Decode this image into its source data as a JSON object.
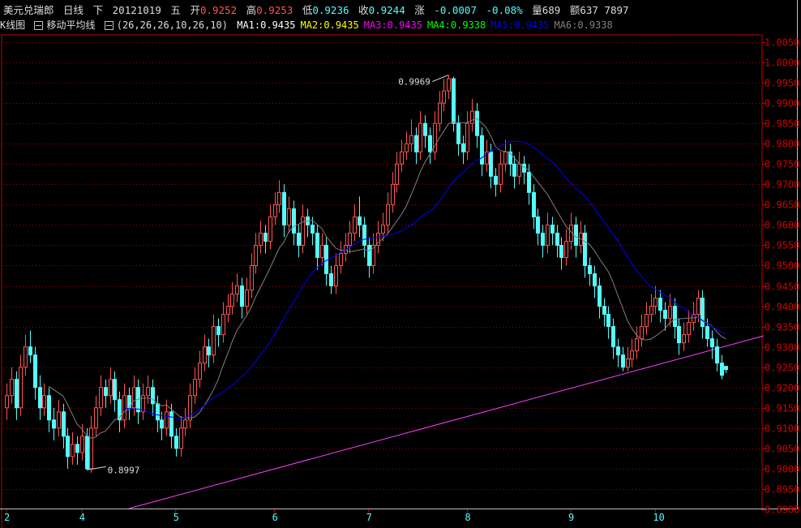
{
  "header": {
    "name": "美元兑瑞郎",
    "period": "日线",
    "dir": "下",
    "date": "20121019",
    "weekday": "五",
    "open_label": "开",
    "open": "0.9252",
    "high_label": "高",
    "high": "0.9253",
    "low_label": "低",
    "low": "0.9236",
    "close_label": "收",
    "close": "0.9244",
    "chg_label": "涨",
    "chg": "-0.0007",
    "chg_pct": "-0.08%",
    "vol": "量689",
    "amt": "额637 7897"
  },
  "indicator": {
    "kline_label": "K线图",
    "ma_label": "移动平均线",
    "params": "(26,26,26,10,26,10)",
    "ma": [
      {
        "label": "MA1:0.9435",
        "color": "#ffffff"
      },
      {
        "label": "MA2:0.9435",
        "color": "#ffff00"
      },
      {
        "label": "MA3:0.9435",
        "color": "#ff00ff"
      },
      {
        "label": "MA4:0.9338",
        "color": "#00ff00"
      },
      {
        "label": "MA5:0.9435",
        "color": "#0000ff"
      },
      {
        "label": "MA6:0.9338",
        "color": "#808080"
      }
    ]
  },
  "colors": {
    "up": "#ff5454",
    "down": "#54fcfc",
    "grid": "#a00000",
    "axis": "#c00000",
    "trend": "#ff40ff",
    "ma_short": "#808080",
    "ma_long": "#0000ff"
  },
  "chart_data": {
    "type": "candlestick",
    "ylim": [
      0.89,
      1.005
    ],
    "yticks": [
      "1.0050",
      "1.0000",
      "0.9950",
      "0.9900",
      "0.9850",
      "0.9800",
      "0.9750",
      "0.9700",
      "0.9650",
      "0.9600",
      "0.9550",
      "0.9500",
      "0.9450",
      "0.9400",
      "0.9350",
      "0.9300",
      "0.9250",
      "0.9200",
      "0.9150",
      "0.9100",
      "0.9050",
      "0.9000",
      "0.8950",
      "0.8900"
    ],
    "xticks": [
      {
        "i": 0,
        "label": "2"
      },
      {
        "i": 16,
        "label": "4"
      },
      {
        "i": 36,
        "label": "5"
      },
      {
        "i": 57,
        "label": "6"
      },
      {
        "i": 77,
        "label": "7"
      },
      {
        "i": 98,
        "label": "8"
      },
      {
        "i": 120,
        "label": "9"
      },
      {
        "i": 138,
        "label": "10"
      }
    ],
    "ma_periods": [
      10,
      26
    ],
    "annotations": [
      {
        "i": 94,
        "price": 0.9969,
        "label": "0.9969"
      },
      {
        "i": 17,
        "price": 0.8997,
        "label": "0.8997"
      }
    ],
    "trendline": [
      {
        "i": 26,
        "price": 0.8902
      },
      {
        "i": 161,
        "price": 0.9327
      }
    ],
    "ohlc": [
      [
        0.915,
        0.921,
        0.912,
        0.918
      ],
      [
        0.918,
        0.925,
        0.916,
        0.922
      ],
      [
        0.922,
        0.924,
        0.912,
        0.915
      ],
      [
        0.915,
        0.928,
        0.913,
        0.925
      ],
      [
        0.925,
        0.933,
        0.923,
        0.93
      ],
      [
        0.93,
        0.934,
        0.926,
        0.928
      ],
      [
        0.928,
        0.93,
        0.917,
        0.92
      ],
      [
        0.92,
        0.923,
        0.912,
        0.915
      ],
      [
        0.915,
        0.921,
        0.913,
        0.918
      ],
      [
        0.918,
        0.92,
        0.909,
        0.912
      ],
      [
        0.912,
        0.915,
        0.907,
        0.91
      ],
      [
        0.91,
        0.917,
        0.908,
        0.914
      ],
      [
        0.914,
        0.916,
        0.905,
        0.908
      ],
      [
        0.908,
        0.91,
        0.9,
        0.903
      ],
      [
        0.903,
        0.909,
        0.901,
        0.906
      ],
      [
        0.906,
        0.908,
        0.901,
        0.904
      ],
      [
        0.904,
        0.911,
        0.902,
        0.908
      ],
      [
        0.908,
        0.91,
        0.8997,
        0.9
      ],
      [
        0.9,
        0.913,
        0.899,
        0.91
      ],
      [
        0.91,
        0.918,
        0.908,
        0.915
      ],
      [
        0.915,
        0.923,
        0.913,
        0.92
      ],
      [
        0.92,
        0.922,
        0.915,
        0.918
      ],
      [
        0.918,
        0.925,
        0.916,
        0.922
      ],
      [
        0.922,
        0.924,
        0.914,
        0.917
      ],
      [
        0.917,
        0.919,
        0.909,
        0.912
      ],
      [
        0.912,
        0.921,
        0.91,
        0.918
      ],
      [
        0.918,
        0.92,
        0.912,
        0.915
      ],
      [
        0.915,
        0.923,
        0.913,
        0.92
      ],
      [
        0.92,
        0.922,
        0.911,
        0.914
      ],
      [
        0.914,
        0.921,
        0.912,
        0.918
      ],
      [
        0.918,
        0.923,
        0.916,
        0.92
      ],
      [
        0.92,
        0.922,
        0.913,
        0.916
      ],
      [
        0.916,
        0.918,
        0.909,
        0.912
      ],
      [
        0.912,
        0.914,
        0.907,
        0.91
      ],
      [
        0.91,
        0.917,
        0.908,
        0.914
      ],
      [
        0.914,
        0.916,
        0.905,
        0.908
      ],
      [
        0.908,
        0.91,
        0.903,
        0.905
      ],
      [
        0.905,
        0.913,
        0.903,
        0.91
      ],
      [
        0.91,
        0.915,
        0.908,
        0.912
      ],
      [
        0.912,
        0.921,
        0.91,
        0.918
      ],
      [
        0.918,
        0.925,
        0.916,
        0.922
      ],
      [
        0.922,
        0.929,
        0.92,
        0.926
      ],
      [
        0.926,
        0.933,
        0.924,
        0.93
      ],
      [
        0.93,
        0.932,
        0.925,
        0.928
      ],
      [
        0.928,
        0.938,
        0.926,
        0.935
      ],
      [
        0.935,
        0.937,
        0.93,
        0.933
      ],
      [
        0.933,
        0.941,
        0.931,
        0.938
      ],
      [
        0.938,
        0.943,
        0.936,
        0.94
      ],
      [
        0.94,
        0.946,
        0.938,
        0.943
      ],
      [
        0.943,
        0.948,
        0.941,
        0.945
      ],
      [
        0.945,
        0.947,
        0.937,
        0.94
      ],
      [
        0.94,
        0.947,
        0.938,
        0.944
      ],
      [
        0.944,
        0.953,
        0.942,
        0.95
      ],
      [
        0.95,
        0.958,
        0.948,
        0.955
      ],
      [
        0.955,
        0.961,
        0.953,
        0.958
      ],
      [
        0.958,
        0.96,
        0.953,
        0.956
      ],
      [
        0.956,
        0.965,
        0.954,
        0.962
      ],
      [
        0.962,
        0.968,
        0.96,
        0.965
      ],
      [
        0.965,
        0.971,
        0.963,
        0.968
      ],
      [
        0.968,
        0.97,
        0.957,
        0.96
      ],
      [
        0.96,
        0.967,
        0.958,
        0.964
      ],
      [
        0.964,
        0.966,
        0.955,
        0.958
      ],
      [
        0.958,
        0.96,
        0.952,
        0.955
      ],
      [
        0.955,
        0.965,
        0.953,
        0.962
      ],
      [
        0.962,
        0.964,
        0.957,
        0.96
      ],
      [
        0.96,
        0.962,
        0.955,
        0.958
      ],
      [
        0.958,
        0.96,
        0.949,
        0.952
      ],
      [
        0.952,
        0.958,
        0.95,
        0.955
      ],
      [
        0.955,
        0.957,
        0.945,
        0.948
      ],
      [
        0.948,
        0.95,
        0.943,
        0.945
      ],
      [
        0.945,
        0.953,
        0.943,
        0.95
      ],
      [
        0.95,
        0.956,
        0.948,
        0.953
      ],
      [
        0.953,
        0.958,
        0.951,
        0.955
      ],
      [
        0.955,
        0.961,
        0.953,
        0.958
      ],
      [
        0.958,
        0.965,
        0.956,
        0.962
      ],
      [
        0.962,
        0.967,
        0.957,
        0.96
      ],
      [
        0.96,
        0.962,
        0.952,
        0.955
      ],
      [
        0.955,
        0.957,
        0.947,
        0.95
      ],
      [
        0.95,
        0.958,
        0.948,
        0.955
      ],
      [
        0.955,
        0.961,
        0.953,
        0.958
      ],
      [
        0.958,
        0.963,
        0.956,
        0.96
      ],
      [
        0.96,
        0.968,
        0.958,
        0.965
      ],
      [
        0.965,
        0.973,
        0.963,
        0.97
      ],
      [
        0.97,
        0.978,
        0.968,
        0.975
      ],
      [
        0.975,
        0.981,
        0.973,
        0.978
      ],
      [
        0.978,
        0.983,
        0.976,
        0.98
      ],
      [
        0.98,
        0.986,
        0.978,
        0.982
      ],
      [
        0.982,
        0.984,
        0.975,
        0.978
      ],
      [
        0.978,
        0.988,
        0.976,
        0.985
      ],
      [
        0.985,
        0.987,
        0.979,
        0.982
      ],
      [
        0.982,
        0.984,
        0.975,
        0.978
      ],
      [
        0.978,
        0.988,
        0.976,
        0.985
      ],
      [
        0.985,
        0.993,
        0.983,
        0.99
      ],
      [
        0.99,
        0.996,
        0.988,
        0.993
      ],
      [
        0.993,
        0.9969,
        0.991,
        0.996
      ],
      [
        0.996,
        0.9965,
        0.983,
        0.985
      ],
      [
        0.985,
        0.987,
        0.977,
        0.98
      ],
      [
        0.98,
        0.982,
        0.975,
        0.978
      ],
      [
        0.978,
        0.988,
        0.976,
        0.985
      ],
      [
        0.985,
        0.991,
        0.983,
        0.988
      ],
      [
        0.988,
        0.99,
        0.979,
        0.982
      ],
      [
        0.982,
        0.984,
        0.972,
        0.975
      ],
      [
        0.975,
        0.981,
        0.973,
        0.978
      ],
      [
        0.978,
        0.98,
        0.969,
        0.972
      ],
      [
        0.972,
        0.974,
        0.967,
        0.97
      ],
      [
        0.97,
        0.978,
        0.968,
        0.975
      ],
      [
        0.975,
        0.981,
        0.973,
        0.978
      ],
      [
        0.978,
        0.98,
        0.972,
        0.975
      ],
      [
        0.975,
        0.977,
        0.969,
        0.972
      ],
      [
        0.972,
        0.978,
        0.97,
        0.975
      ],
      [
        0.975,
        0.977,
        0.97,
        0.973
      ],
      [
        0.973,
        0.975,
        0.965,
        0.968
      ],
      [
        0.968,
        0.97,
        0.959,
        0.962
      ],
      [
        0.962,
        0.964,
        0.955,
        0.958
      ],
      [
        0.958,
        0.96,
        0.952,
        0.955
      ],
      [
        0.955,
        0.963,
        0.953,
        0.96
      ],
      [
        0.96,
        0.962,
        0.955,
        0.958
      ],
      [
        0.958,
        0.96,
        0.952,
        0.955
      ],
      [
        0.955,
        0.957,
        0.949,
        0.952
      ],
      [
        0.952,
        0.959,
        0.95,
        0.956
      ],
      [
        0.956,
        0.963,
        0.954,
        0.96
      ],
      [
        0.96,
        0.962,
        0.952,
        0.955
      ],
      [
        0.955,
        0.961,
        0.953,
        0.958
      ],
      [
        0.958,
        0.96,
        0.947,
        0.95
      ],
      [
        0.95,
        0.952,
        0.945,
        0.948
      ],
      [
        0.948,
        0.95,
        0.942,
        0.945
      ],
      [
        0.945,
        0.947,
        0.937,
        0.94
      ],
      [
        0.94,
        0.942,
        0.935,
        0.938
      ],
      [
        0.938,
        0.94,
        0.932,
        0.935
      ],
      [
        0.935,
        0.937,
        0.927,
        0.93
      ],
      [
        0.93,
        0.932,
        0.925,
        0.928
      ],
      [
        0.928,
        0.93,
        0.924,
        0.925
      ],
      [
        0.925,
        0.93,
        0.924,
        0.927
      ],
      [
        0.927,
        0.932,
        0.925,
        0.929
      ],
      [
        0.929,
        0.935,
        0.927,
        0.932
      ],
      [
        0.932,
        0.938,
        0.93,
        0.935
      ],
      [
        0.935,
        0.941,
        0.933,
        0.938
      ],
      [
        0.938,
        0.943,
        0.936,
        0.94
      ],
      [
        0.94,
        0.945,
        0.938,
        0.942
      ],
      [
        0.942,
        0.944,
        0.936,
        0.939
      ],
      [
        0.939,
        0.941,
        0.934,
        0.937
      ],
      [
        0.937,
        0.943,
        0.935,
        0.94
      ],
      [
        0.94,
        0.942,
        0.932,
        0.935
      ],
      [
        0.935,
        0.937,
        0.928,
        0.931
      ],
      [
        0.931,
        0.936,
        0.929,
        0.933
      ],
      [
        0.933,
        0.939,
        0.931,
        0.936
      ],
      [
        0.936,
        0.941,
        0.934,
        0.938
      ],
      [
        0.938,
        0.944,
        0.936,
        0.942
      ],
      [
        0.942,
        0.944,
        0.932,
        0.935
      ],
      [
        0.935,
        0.937,
        0.93,
        0.932
      ],
      [
        0.932,
        0.934,
        0.927,
        0.93
      ],
      [
        0.93,
        0.932,
        0.924,
        0.926
      ],
      [
        0.926,
        0.928,
        0.922,
        0.923
      ],
      [
        0.9252,
        0.9253,
        0.9236,
        0.9244
      ]
    ]
  }
}
